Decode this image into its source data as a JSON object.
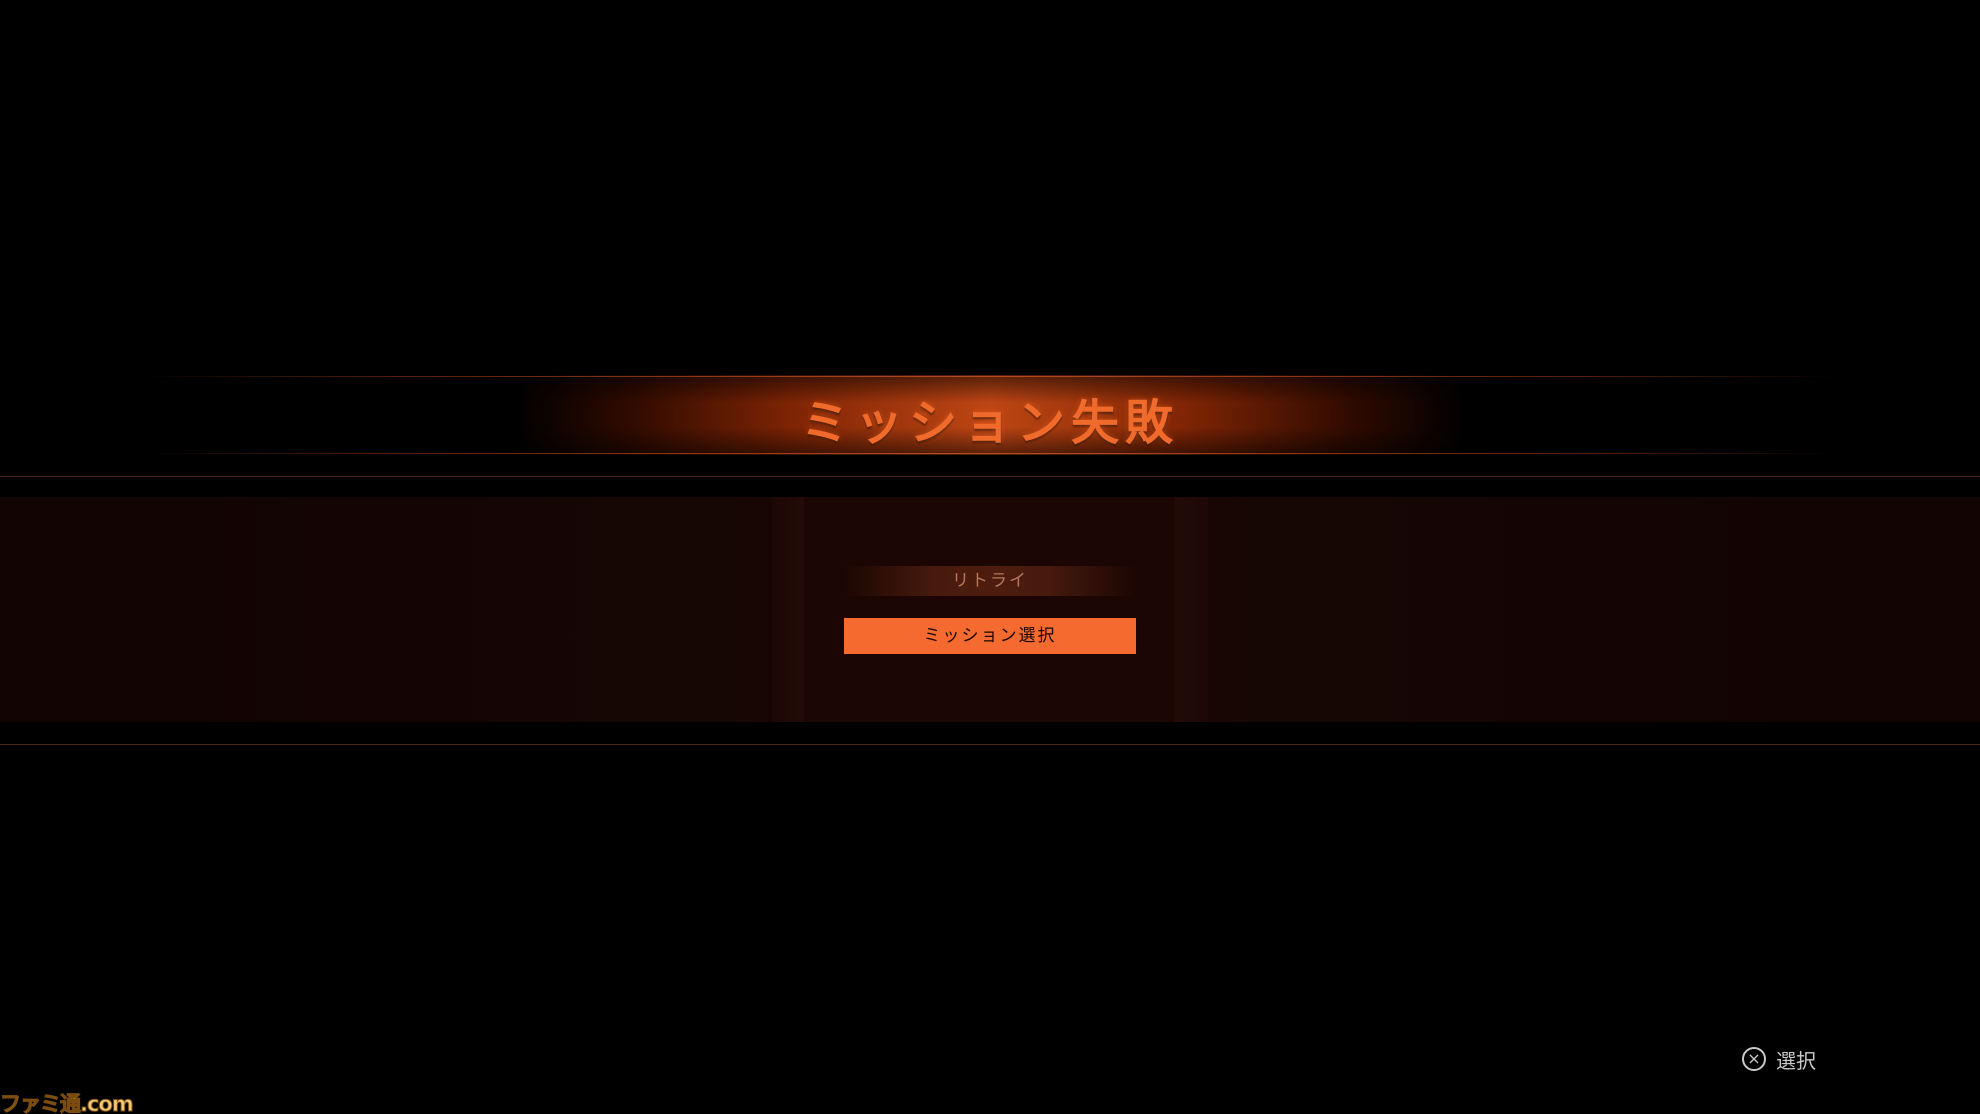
{
  "banner": {
    "title": "ミッション失敗"
  },
  "menu": {
    "items": [
      {
        "label": "リトライ",
        "selected": false
      },
      {
        "label": "ミッション選択",
        "selected": true
      }
    ]
  },
  "hint": {
    "icon": "cross-button-icon",
    "label": "選択"
  },
  "watermark": {
    "text": "ファミ通.com"
  },
  "colors": {
    "accent": "#f46a2f",
    "title": "#f06a2c",
    "unselected_text": "#b7775a",
    "background": "#000000"
  }
}
